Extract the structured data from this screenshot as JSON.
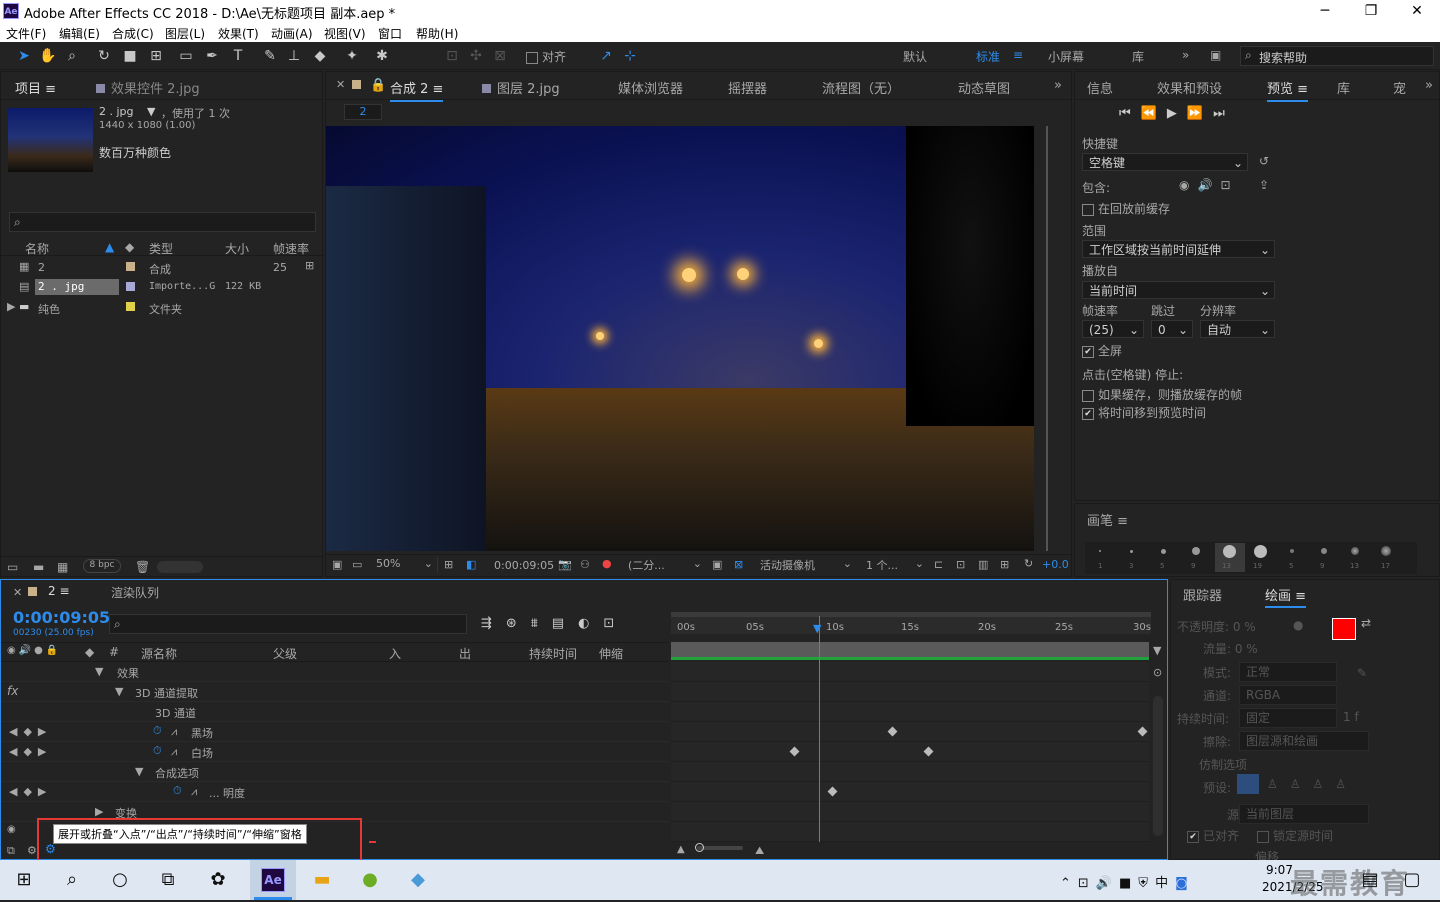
{
  "window": {
    "title": "Adobe After Effects CC 2018 - D:\\Ae\\无标题项目 副本.aep *",
    "app_icon": "Ae",
    "min": "─",
    "max": "❐",
    "close": "✕"
  },
  "menu": [
    "文件(F)",
    "编辑(E)",
    "合成(C)",
    "图层(L)",
    "效果(T)",
    "动画(A)",
    "视图(V)",
    "窗口",
    "帮助(H)"
  ],
  "toolbar": {
    "align": "对齐",
    "workspaces": [
      "默认",
      "标准",
      "小屏幕",
      "库"
    ],
    "search_placeholder": "搜索帮助"
  },
  "project": {
    "tab": "项目",
    "effects_tab": "效果控件 2.jpg",
    "item_name": "2 . jpg",
    "used": "，使用了 1 次",
    "dims": "1440 x 1080 (1.00)",
    "colors": "数百万种颜色",
    "columns": [
      "名称",
      "类型",
      "大小",
      "帧速率"
    ],
    "rows": [
      {
        "name": "2",
        "type": "合成",
        "size": "",
        "fps": "25"
      },
      {
        "name": "2 . jpg",
        "type": "Importe...G",
        "size": "122 KB",
        "fps": ""
      },
      {
        "name": "纯色",
        "type": "文件夹",
        "size": "",
        "fps": ""
      }
    ],
    "bpc": "8 bpc"
  },
  "viewer": {
    "tabs": [
      "合成 2",
      "图层 2.jpg",
      "媒体浏览器",
      "摇摆器",
      "流程图（无）",
      "动态草图"
    ],
    "crumb": "2",
    "zoom": "50%",
    "time": "0:00:09:05",
    "quality": "(二分...",
    "camera": "活动摄像机",
    "views": "1 个...",
    "exposure": "+0.0"
  },
  "preview": {
    "tabs": [
      "信息",
      "效果和预设",
      "预览",
      "库"
    ],
    "shortcut_label": "快捷键",
    "shortcut": "空格键",
    "include": "包含:",
    "cache_before": "在回放前缓存",
    "range_label": "范围",
    "range": "工作区域按当前时间延伸",
    "play_from_label": "播放自",
    "play_from": "当前时间",
    "fps_label": "帧速率",
    "skip_label": "跳过",
    "res_label": "分辨率",
    "fps": "(25)",
    "skip": "0",
    "res": "自动",
    "fullscreen": "全屏",
    "stop_label": "点击(空格键) 停止:",
    "if_cached": "如果缓存，则播放缓存的帧",
    "move_time": "将时间移到预览时间"
  },
  "brushes": {
    "tab": "画笔",
    "sizes": [
      "1",
      "3",
      "5",
      "9",
      "13",
      "19",
      "5",
      "9",
      "13",
      "17"
    ]
  },
  "timeline": {
    "comp_tab": "2",
    "render_tab": "渲染队列",
    "timecode": "0:00:09:05",
    "frames": "00230 (25.00 fps)",
    "columns": [
      "源名称",
      "父级",
      "入",
      "出",
      "持续时间",
      "伸缩"
    ],
    "ruler": [
      "00s",
      "05s",
      "10s",
      "15s",
      "20s",
      "25s",
      "30s"
    ],
    "layers": [
      {
        "name": "效果",
        "indent": 1
      },
      {
        "name": "3D 通道提取",
        "indent": 2
      },
      {
        "name": "3D 通道",
        "indent": 3
      },
      {
        "name": "黑场",
        "indent": 3
      },
      {
        "name": "白场",
        "indent": 3
      },
      {
        "name": "合成选项",
        "indent": 2
      },
      {
        "name": "... 明度",
        "indent": 3
      },
      {
        "name": "变换",
        "indent": 1
      }
    ],
    "tooltip": "展开或折叠“入点”/“出点”/“持续时间”/“伸缩”窗格"
  },
  "paint": {
    "tabs": [
      "跟踪器",
      "绘画"
    ],
    "opacity": "不透明度: 0 %",
    "flow": "流量: 0 %",
    "mode_label": "模式:",
    "mode": "正常",
    "channel_label": "通道:",
    "channel": "RGBA",
    "duration_label": "持续时间:",
    "duration": "固定",
    "duration_unit": "1 f",
    "erase_label": "擦除:",
    "erase": "图层源和绘画",
    "clone": "仿制选项",
    "preset": "预设:",
    "source_label": "源:",
    "source": "当前图层",
    "aligned": "已对齐",
    "lock_time": "锁定源时间",
    "offset": "偏移"
  },
  "taskbar": {
    "time": "9:07",
    "date": "2021/2/25",
    "ime": "中",
    "watermark": "最需教育"
  }
}
